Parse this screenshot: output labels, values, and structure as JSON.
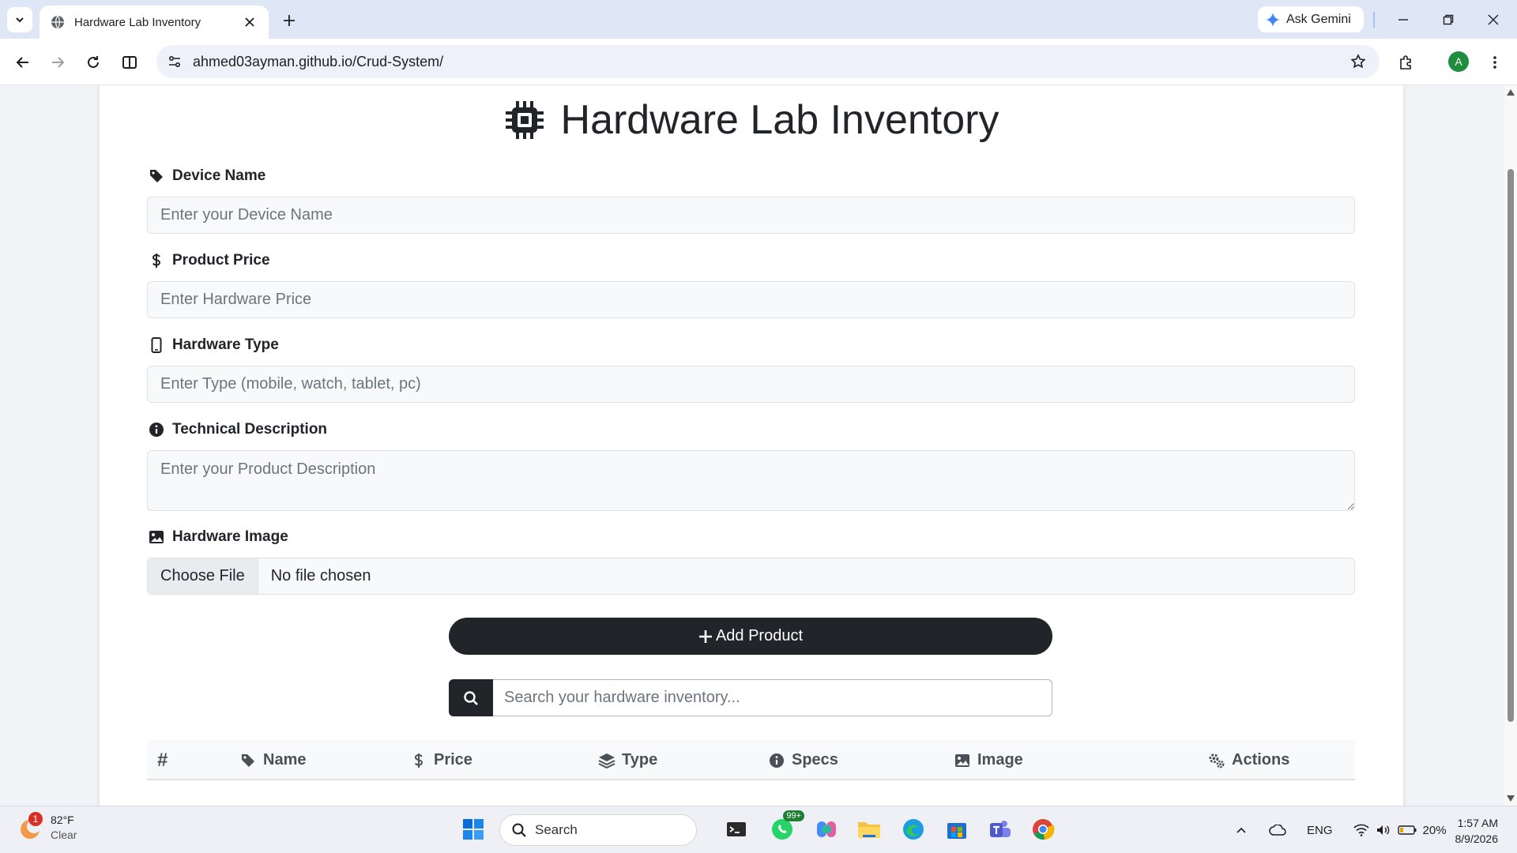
{
  "browser": {
    "tab_title": "Hardware Lab Inventory",
    "url": "ahmed03ayman.github.io/Crud-System/",
    "gemini_label": "Ask Gemini",
    "profile_initial": "A"
  },
  "page": {
    "title": "Hardware Lab Inventory",
    "fields": {
      "device_name": {
        "label": "Device Name",
        "placeholder": "Enter your Device Name"
      },
      "price": {
        "label": "Product Price",
        "placeholder": "Enter Hardware Price"
      },
      "type": {
        "label": "Hardware Type",
        "placeholder": "Enter Type (mobile, watch, tablet, pc)"
      },
      "description": {
        "label": "Technical Description",
        "placeholder": "Enter your Product Description"
      },
      "image": {
        "label": "Hardware Image",
        "button": "Choose File",
        "status": "No file chosen"
      }
    },
    "add_button": "Add Product",
    "search_placeholder": "Search your hardware inventory...",
    "table_headers": {
      "index": "#",
      "name": "Name",
      "price": "Price",
      "type": "Type",
      "specs": "Specs",
      "image": "Image",
      "actions": "Actions"
    }
  },
  "taskbar": {
    "weather_temp": "82°F",
    "weather_desc": "Clear",
    "weather_badge": "1",
    "search_label": "Search",
    "whatsapp_badge": "99+",
    "language": "ENG",
    "battery": "20%",
    "time": "1:57 AM",
    "date": "8/9/2026"
  }
}
